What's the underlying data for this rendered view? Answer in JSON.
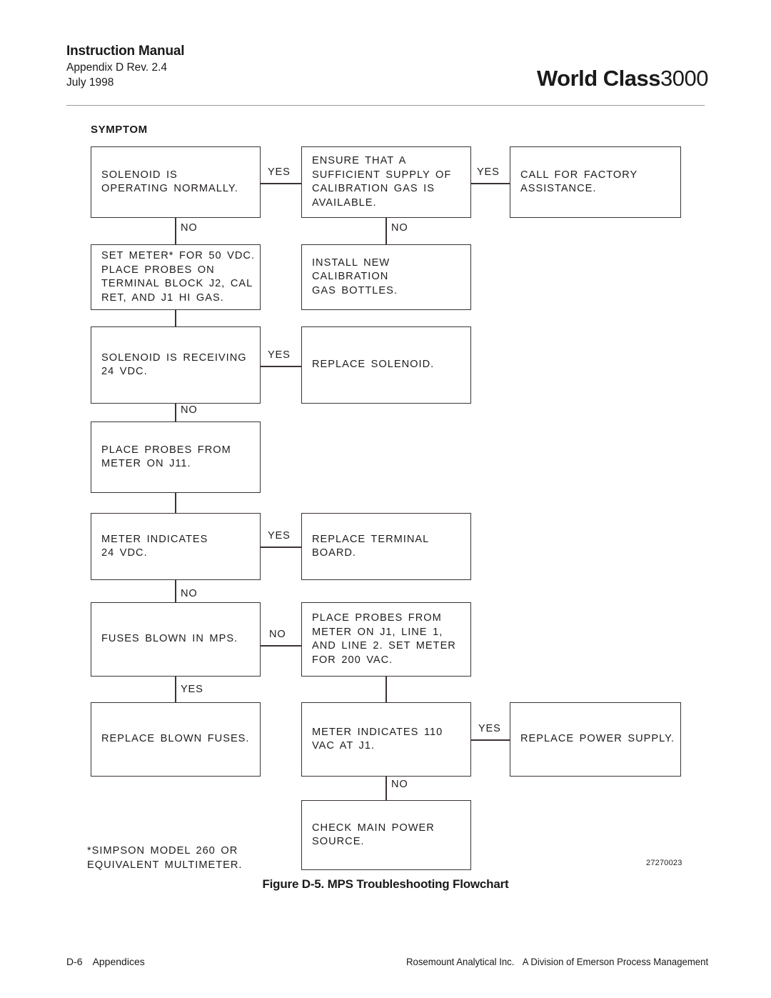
{
  "header": {
    "manual_title": "Instruction Manual",
    "appendix": "Appendix D  Rev. 2.4",
    "date": "July 1998",
    "brand_name": "World Class",
    "brand_number": "3000"
  },
  "flowchart": {
    "symptom_label": "SYMPTOM",
    "boxes": [
      {
        "id": "solenoid-operating-normally",
        "text": "SOLENOID IS\nOPERATING NORMALLY."
      },
      {
        "id": "ensure-sufficient-calibration-gas",
        "text": "ENSURE  THAT  A\nSUFFICIENT  SUPPLY  OF\nCALIBRATION  GAS  IS\nAVAILABLE."
      },
      {
        "id": "call-for-factory-assistance",
        "text": "CALL  FOR  FACTORY\nASSISTANCE."
      },
      {
        "id": "set-meter-50-vdc",
        "text": "SET  METER*  FOR  50  VDC.\nPLACE  PROBES  ON\nTERMINAL  BLOCK  J2,  CAL\nRET,  AND  J1  HI  GAS."
      },
      {
        "id": "install-new-calibration-gas-bottles",
        "text": "INSTALL  NEW  CALIBRATION\nGAS BOTTLES."
      },
      {
        "id": "solenoid-receiving-24-vdc",
        "text": "SOLENOID  IS  RECEIVING\n24  VDC."
      },
      {
        "id": "replace-solenoid",
        "text": "REPLACE  SOLENOID."
      },
      {
        "id": "place-probes-on-j11",
        "text": "PLACE  PROBES  FROM\nMETER  ON  J11."
      },
      {
        "id": "meter-indicates-24-vdc",
        "text": "METER  INDICATES\n24  VDC."
      },
      {
        "id": "replace-terminal-board",
        "text": "REPLACE  TERMINAL\nBOARD."
      },
      {
        "id": "fuses-blown-in-mps",
        "text": "FUSES  BLOWN  IN  MPS."
      },
      {
        "id": "place-probes-on-j1-lines",
        "text": "PLACE  PROBES  FROM\nMETER  ON  J1,  LINE  1,\nAND  LINE  2.  SET  METER\nFOR  200  VAC."
      },
      {
        "id": "replace-blown-fuses",
        "text": "REPLACE  BLOWN  FUSES."
      },
      {
        "id": "meter-indicates-110-vac",
        "text": "METER  INDICATES  110\nVAC  AT  J1."
      },
      {
        "id": "replace-power-supply",
        "text": "REPLACE  POWER  SUPPLY."
      },
      {
        "id": "check-main-power-source",
        "text": "CHECK  MAIN  POWER\nSOURCE."
      }
    ],
    "edge_labels": {
      "yes_solenoid_to_ensure": "YES",
      "yes_ensure_to_call": "YES",
      "no_solenoid_to_setmeter": "NO",
      "no_ensure_to_install": "NO",
      "yes_receiving_to_replace_solenoid": "YES",
      "no_receiving_to_place_probes": "NO",
      "yes_meter24_to_replace_terminal": "YES",
      "no_meter24_to_fuses": "NO",
      "no_fuses_to_place_probes_j1": "NO",
      "yes_fuses_to_replace_fuses": "YES",
      "yes_meter110_to_replace_ps": "YES",
      "no_meter110_to_check_main": "NO"
    }
  },
  "footnote": "*SIMPSON  MODEL  260  OR\nEQUIVALENT  MULTIMETER.",
  "drawing_number": "27270023",
  "figure_caption": "Figure D-5.  MPS Troubleshooting Flowchart",
  "footer": {
    "page_number": "D-6",
    "section": "Appendices",
    "company": "Rosemount Analytical Inc.",
    "division": "A Division of Emerson Process Management"
  },
  "colors": {
    "box_border": "#3b3235",
    "text": "#201c1e",
    "rule": "#9a9a9a"
  }
}
